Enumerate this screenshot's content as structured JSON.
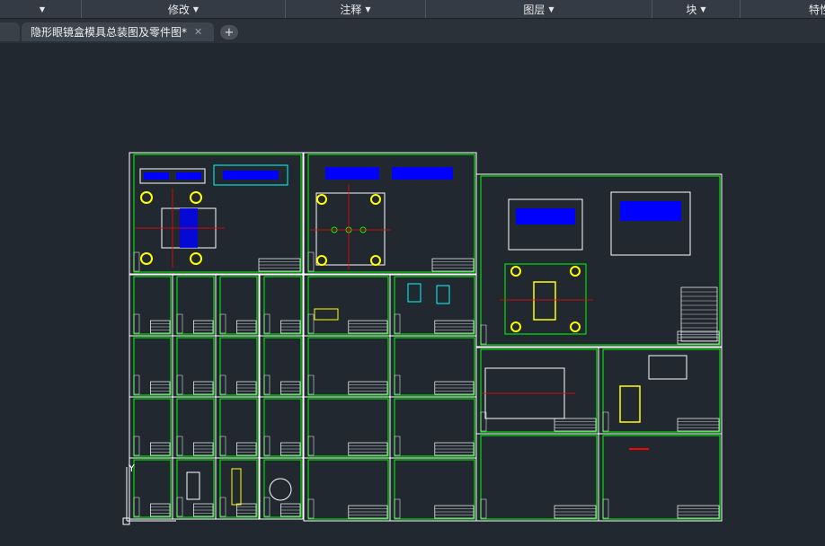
{
  "ribbon": {
    "panels": [
      {
        "label": ""
      },
      {
        "label": "修改"
      },
      {
        "label": "注释"
      },
      {
        "label": "图层"
      },
      {
        "label": "块"
      },
      {
        "label": "特性"
      }
    ]
  },
  "tabs": {
    "active": {
      "label": "隐形眼镜盒模具总装图及零件图*",
      "close_symbol": "✕"
    },
    "new_tab_symbol": "+"
  },
  "drawing": {
    "background_color": "#212830",
    "border_color": "#ffffff",
    "frame_color": "#00ff00",
    "accent_colors": [
      "#ffff00",
      "#0000ff",
      "#ff0000",
      "#00ffff"
    ],
    "ucs_label": "Y"
  }
}
